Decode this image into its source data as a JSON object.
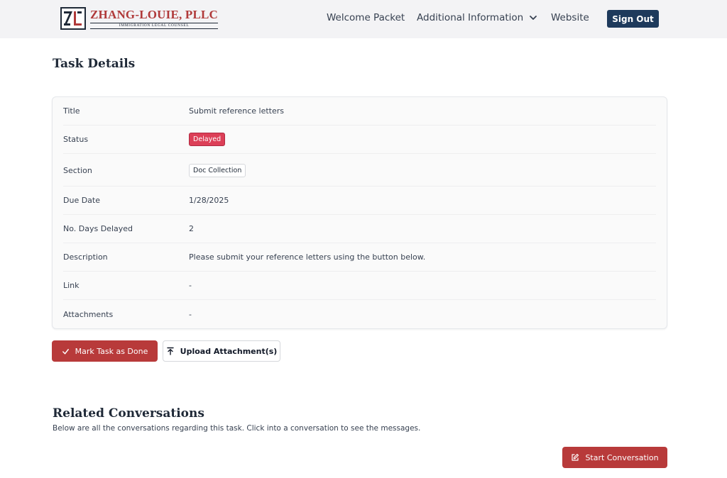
{
  "brand": {
    "name": "ZHANG-LOUIE, PLLC",
    "tagline": "IMMIGRATION LEGAL COUNSEL"
  },
  "nav": {
    "welcome_packet": "Welcome Packet",
    "additional_information": "Additional Information",
    "website": "Website",
    "sign_out": "Sign Out"
  },
  "task": {
    "heading": "Task Details",
    "rows": [
      {
        "label": "Title",
        "value": "Submit reference letters"
      },
      {
        "label": "Status",
        "value": "Delayed"
      },
      {
        "label": "Section",
        "value": "Doc Collection"
      },
      {
        "label": "Due Date",
        "value": "1/28/2025"
      },
      {
        "label": "No. Days Delayed",
        "value": "2"
      },
      {
        "label": "Description",
        "value": "Please submit your reference letters using the button below."
      },
      {
        "label": "Link",
        "value": "-"
      },
      {
        "label": "Attachments",
        "value": "-"
      }
    ],
    "mark_done_label": "Mark Task as Done",
    "upload_label": "Upload Attachment(s)"
  },
  "conversations": {
    "heading": "Related Conversations",
    "description": "Below are all the conversations regarding this task. Click into a conversation to see the messages.",
    "start_label": "Start Conversation"
  },
  "colors": {
    "accent_red": "#b83a3a",
    "status_delayed": "#dc3f57",
    "nav_button": "#1e3a5c"
  },
  "icons": {
    "nav_dropdown": "chevron-down-icon",
    "mark_done": "check-icon",
    "upload": "upload-icon",
    "start_conversation": "edit-icon"
  }
}
